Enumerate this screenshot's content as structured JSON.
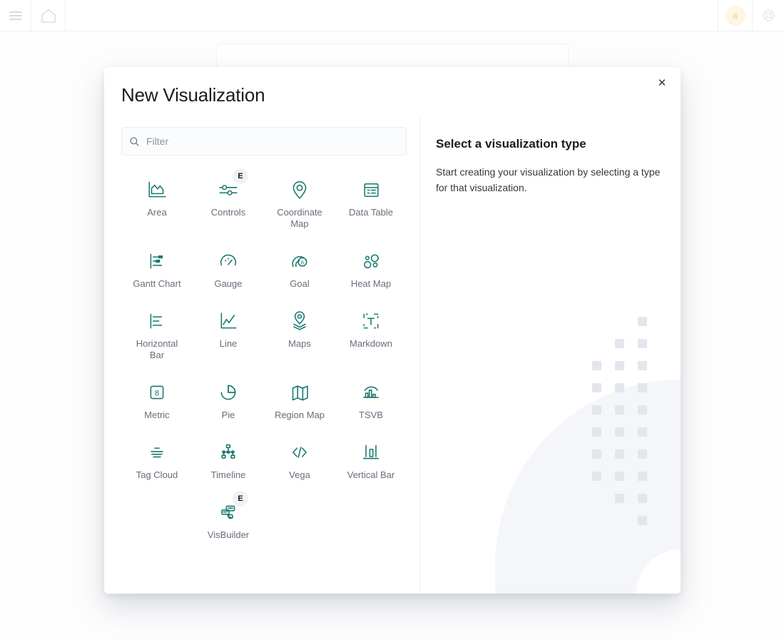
{
  "topbar": {
    "menu_icon": "hamburger-menu-icon",
    "home_icon": "home-icon",
    "avatar_initial": "a",
    "help_icon": "help-lifebuoy-icon"
  },
  "modal": {
    "title": "New Visualization",
    "close_glyph": "✕",
    "filter": {
      "value": "",
      "placeholder": "Filter",
      "icon": "search-icon"
    },
    "vis_types": [
      {
        "label": "Area",
        "icon": "area-chart-icon",
        "experimental": false,
        "badge": ""
      },
      {
        "label": "Controls",
        "icon": "sliders-icon",
        "experimental": true,
        "badge": "E"
      },
      {
        "label": "Coordinate Map",
        "icon": "map-pin-icon",
        "experimental": false,
        "badge": ""
      },
      {
        "label": "Data Table",
        "icon": "table-icon",
        "experimental": false,
        "badge": ""
      },
      {
        "label": "Gantt Chart",
        "icon": "gantt-chart-icon",
        "experimental": false,
        "badge": ""
      },
      {
        "label": "Gauge",
        "icon": "gauge-icon",
        "experimental": false,
        "badge": ""
      },
      {
        "label": "Goal",
        "icon": "goal-icon",
        "experimental": false,
        "badge": ""
      },
      {
        "label": "Heat Map",
        "icon": "heat-map-icon",
        "experimental": false,
        "badge": ""
      },
      {
        "label": "Horizontal Bar",
        "icon": "horizontal-bar-icon",
        "experimental": false,
        "badge": ""
      },
      {
        "label": "Line",
        "icon": "line-chart-icon",
        "experimental": false,
        "badge": ""
      },
      {
        "label": "Maps",
        "icon": "maps-layers-icon",
        "experimental": false,
        "badge": ""
      },
      {
        "label": "Markdown",
        "icon": "markdown-text-icon",
        "experimental": false,
        "badge": ""
      },
      {
        "label": "Metric",
        "icon": "metric-number-icon",
        "experimental": false,
        "badge": ""
      },
      {
        "label": "Pie",
        "icon": "pie-chart-icon",
        "experimental": false,
        "badge": ""
      },
      {
        "label": "Region Map",
        "icon": "region-map-icon",
        "experimental": false,
        "badge": ""
      },
      {
        "label": "TSVB",
        "icon": "tsvb-icon",
        "experimental": false,
        "badge": ""
      },
      {
        "label": "Tag Cloud",
        "icon": "tag-cloud-icon",
        "experimental": false,
        "badge": ""
      },
      {
        "label": "Timeline",
        "icon": "timeline-tree-icon",
        "experimental": false,
        "badge": ""
      },
      {
        "label": "Vega",
        "icon": "code-brackets-icon",
        "experimental": false,
        "badge": ""
      },
      {
        "label": "Vertical Bar",
        "icon": "vertical-bar-icon",
        "experimental": false,
        "badge": ""
      },
      {
        "label": "VisBuilder",
        "icon": "vis-builder-icon",
        "experimental": true,
        "badge": "E"
      }
    ],
    "right_pane": {
      "title": "Select a visualization type",
      "description": "Start creating your visualization by selecting a type for that visualization."
    }
  },
  "colors": {
    "accent": "#17776d",
    "text_primary": "#1a1c21",
    "text_secondary": "#686e7b",
    "badge_bg": "#f1f2f5",
    "art_square": "#e3e7ed",
    "art_circle": "#f4f6f9",
    "avatar_bg": "#fdf6e3"
  }
}
